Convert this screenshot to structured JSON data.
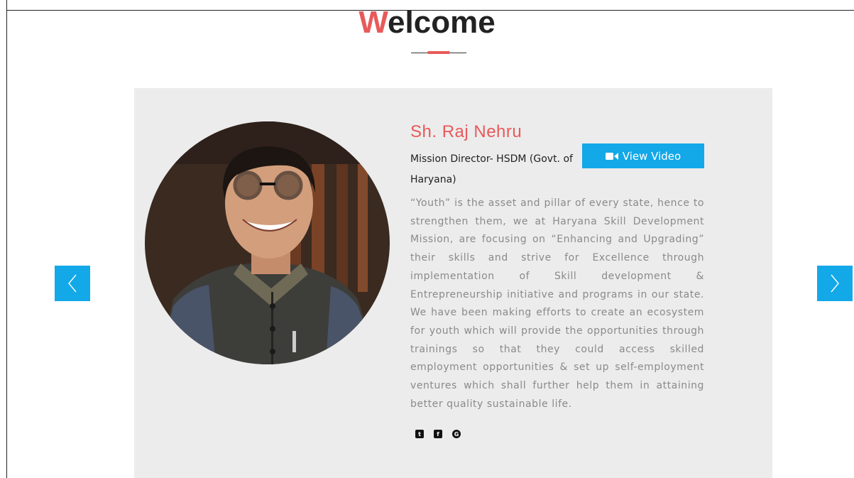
{
  "heading": {
    "first_letter": "W",
    "rest": "elcome"
  },
  "profile": {
    "name": "Sh. Raj Nehru",
    "role": "Mission Director- HSDM (Govt. of Haryana)",
    "video_button_label": "View Video",
    "message": "“Youth” is the asset and pillar of every state, hence to strengthen them, we at Haryana Skill Development Mission, are focusing on “Enhancing and Upgrading” their skills and strive for Excellence through implementation of Skill development & Entrepreneurship initiative and programs in our state. We have been making efforts to create an ecosystem for youth which will provide the opportunities through trainings so that they could access skilled employment opportunities & set up self-employment ventures which shall further help them in attaining better quality sustainable life."
  },
  "social": [
    {
      "icon": "twitter-icon"
    },
    {
      "icon": "facebook-icon"
    },
    {
      "icon": "google-plus-icon"
    }
  ],
  "colors": {
    "accent_red": "#e85a5a",
    "accent_blue": "#13a8e8",
    "card_bg": "#ececec"
  }
}
